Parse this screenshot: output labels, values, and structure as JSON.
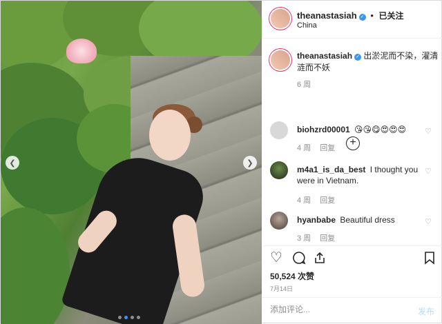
{
  "header": {
    "username": "theanastasiah",
    "follow_label": "已关注",
    "follow_dot": "•",
    "location": "China"
  },
  "caption": {
    "username": "theanastasiah",
    "text": "出淤泥而不染，濯清涟而不妖",
    "time": "6 周"
  },
  "comments": [
    {
      "username": "biohzrd00001",
      "text": "😘😘😋😍😍😍",
      "time": "4 周",
      "reply": "回复"
    },
    {
      "username": "m4a1_is_da_best",
      "text": "I thought you were in Vietnam.",
      "time": "4 周",
      "reply": "回复"
    },
    {
      "username": "hyanbabe",
      "text": "Beautiful dress",
      "time": "3 周",
      "reply": "回复"
    }
  ],
  "likes": "50,524 次赞",
  "date": "7月14日",
  "add_comment": {
    "placeholder": "添加评论...",
    "post_label": "发布"
  },
  "icons": {
    "left_arrow": "❮",
    "right_arrow": "❯",
    "load_more": "+",
    "heart": "♡",
    "comment": "💬",
    "share": "⇪",
    "bookmark": "🔖",
    "verified": "✓"
  },
  "colors": {
    "accent": "#3897f0",
    "post_disabled": "#b2dffc",
    "meta_grey": "#8e8e8e"
  }
}
